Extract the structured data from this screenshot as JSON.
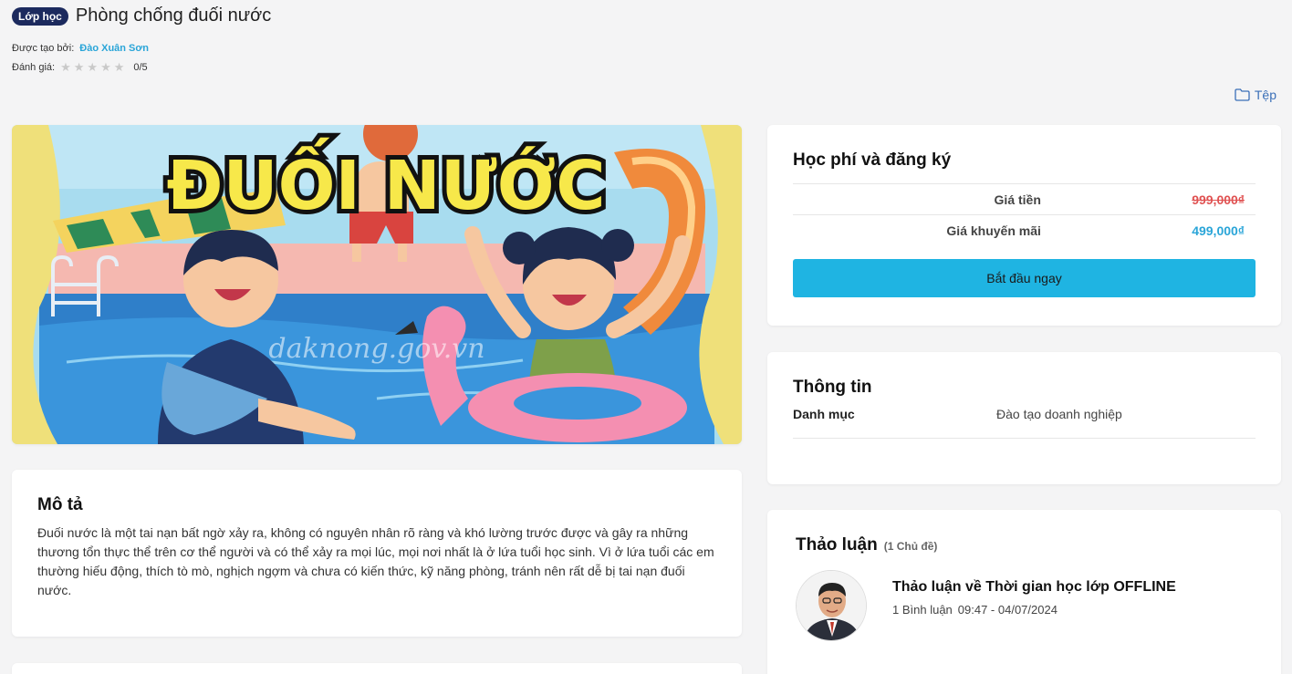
{
  "header": {
    "badge": "Lớp học",
    "title": "Phòng chống đuối nước",
    "trainer_label": "Được tạo bởi:",
    "trainer_name": "Đào Xuân Sơn",
    "rating_label": "Đánh giá:",
    "rating_value": "0/5",
    "rating_stars": 0,
    "files_label": "Tệp"
  },
  "hero": {
    "title_art": "ĐUỐI NƯỚC",
    "watermark": "daknong.gov.vn"
  },
  "description": {
    "heading": "Mô tả",
    "text": "Đuối nước là một tai nạn bất ngờ xảy ra, không có nguyên nhân rõ ràng và khó lường trước được và gây ra những thương tổn thực thể trên cơ thể người và có thể xảy ra mọi lúc, mọi nơi nhất là ở lứa tuổi học sinh. Vì ở lứa tuổi các em thường hiếu động, thích tò mò, nghịch ngợm và chưa có kiến thức, kỹ năng phòng, tránh nên rất dễ bị tai nạn đuối nước."
  },
  "fees": {
    "heading": "Học phí và đăng ký",
    "price_label": "Giá tiền",
    "price_value": "999,000₫",
    "promo_label": "Giá khuyến mãi",
    "promo_value": "499,000₫",
    "start_button": "Bắt đầu ngay"
  },
  "info": {
    "heading": "Thông tin",
    "category_label": "Danh mục",
    "category_value": "Đào tạo doanh nghiệp"
  },
  "discussion": {
    "heading": "Thảo luận",
    "count": "(1 Chủ đề)",
    "thread_title": "Thảo luận về Thời gian học lớp OFFLINE",
    "thread_comments": "1 Bình luận",
    "thread_time": "09:47 - 04/07/2024"
  },
  "colors": {
    "accent": "#1fb4e2",
    "badge": "#1c2a5e",
    "price_old": "#e05252",
    "price_new": "#2aa5d8"
  }
}
